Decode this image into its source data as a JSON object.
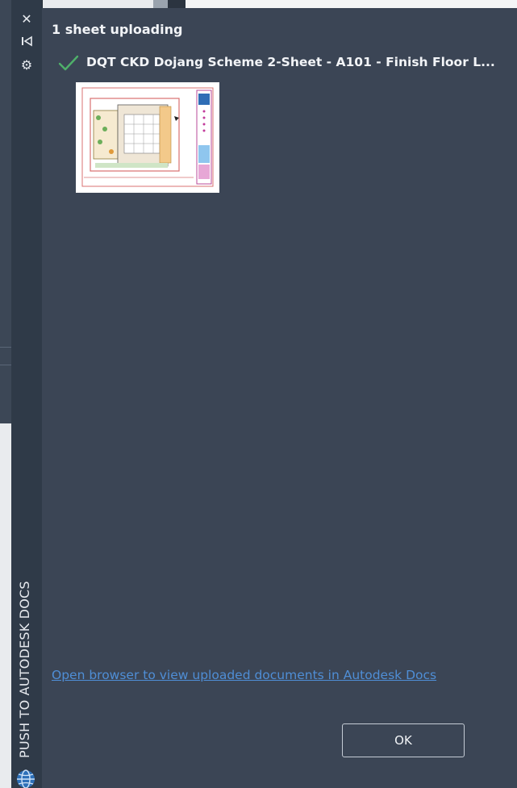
{
  "palette": {
    "vertical_title": "PUSH TO AUTODESK DOCS",
    "close_glyph": "✕",
    "pin_glyph": "⧖",
    "gear_glyph": "⚙",
    "icons": [
      "close-icon",
      "pin-icon",
      "gear-icon",
      "autodesk-globe-icon",
      "checkmark-icon"
    ]
  },
  "upload": {
    "status": "1 sheet uploading",
    "items": [
      {
        "name": "DQT CKD Dojang Scheme 2-Sheet - A101 - Finish Floor L...",
        "state": "complete"
      }
    ]
  },
  "footer": {
    "link_text": "Open browser to view uploaded documents in Autodesk Docs",
    "ok_label": "OK"
  },
  "colors": {
    "panel_bg": "#3b4555",
    "strip_bg": "#2f3a48",
    "check": "#4fb06a",
    "link": "#4f8ed6"
  }
}
